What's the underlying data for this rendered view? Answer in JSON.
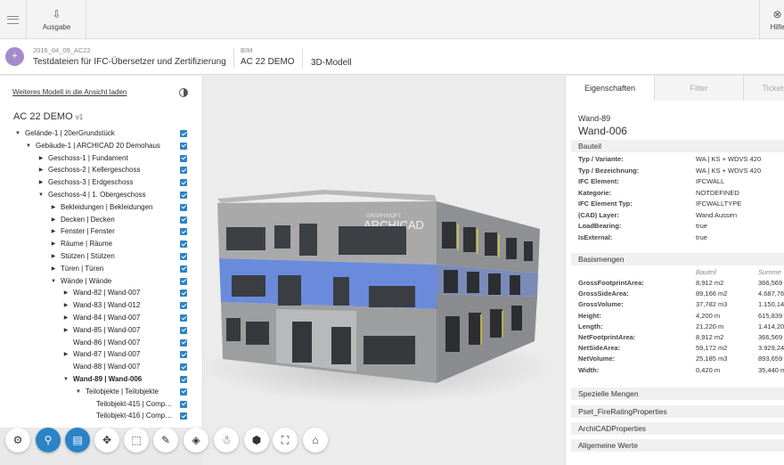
{
  "toolbar": {
    "ausgabe_label": "Ausgabe",
    "hilfe_label": "Hilfe"
  },
  "breadcrumb": {
    "avatar_glyph": "+",
    "project_small": "2016_04_09_AC22",
    "project": "Testdateien für IFC-Übersetzer und Zertifizierung",
    "domain_small": "BIM",
    "model": "AC 22 DEMO",
    "view": "3D-Modell"
  },
  "tree": {
    "add_model_link": "Weiteres Modell in die Ansicht laden",
    "model_title": "AC 22 DEMO",
    "model_version": "v1",
    "items": [
      {
        "label": "Gelände-1 | 20erGrundstück",
        "arrow": "▼"
      },
      {
        "label": "Gebäude-1 | ARCHICAD 20 Demohaus",
        "arrow": "▼"
      },
      {
        "label": "Geschoss-1 | Fundament",
        "arrow": "▶"
      },
      {
        "label": "Geschoss-2 | Kellergeschoss",
        "arrow": "▶"
      },
      {
        "label": "Geschoss-3 | Erdgeschoss",
        "arrow": "▶"
      },
      {
        "label": "Geschoss-4 | 1. Obergeschoss",
        "arrow": "▼"
      },
      {
        "label": "Bekleidungen | Bekleidungen",
        "arrow": "▶"
      },
      {
        "label": "Decken | Decken",
        "arrow": "▶"
      },
      {
        "label": "Fenster | Fenster",
        "arrow": "▶"
      },
      {
        "label": "Räume | Räume",
        "arrow": "▶"
      },
      {
        "label": "Stützen | Stützen",
        "arrow": "▶"
      },
      {
        "label": "Türen | Türen",
        "arrow": "▶"
      },
      {
        "label": "Wände | Wände",
        "arrow": "▼"
      },
      {
        "label": "Wand-82 | Wand-007",
        "arrow": "▶"
      },
      {
        "label": "Wand-83 | Wand-012",
        "arrow": "▶"
      },
      {
        "label": "Wand-84 | Wand-007",
        "arrow": "▶"
      },
      {
        "label": "Wand-85 | Wand-007",
        "arrow": "▶"
      },
      {
        "label": "Wand-86 | Wand-007",
        "arrow": ""
      },
      {
        "label": "Wand-87 | Wand-007",
        "arrow": "▶"
      },
      {
        "label": "Wand-88 | Wand-007",
        "arrow": ""
      },
      {
        "label": "Wand-89 | Wand-006",
        "arrow": "▼"
      },
      {
        "label": "Teilobjekte | Teilobjekte",
        "arrow": "▼"
      },
      {
        "label": "Teilobjekt-415 | Compon…",
        "arrow": ""
      },
      {
        "label": "Teilobjekt-416 | Compon…",
        "arrow": ""
      }
    ]
  },
  "tools": [
    {
      "name": "settings-gear-icon",
      "glyph": "⚙"
    },
    {
      "name": "navigation-mode-icon",
      "glyph": "⚲"
    },
    {
      "name": "storey-view-icon",
      "glyph": "▤"
    },
    {
      "name": "focus-icon",
      "glyph": "✥"
    },
    {
      "name": "selection-box-icon",
      "glyph": "⬚"
    },
    {
      "name": "measure-pencil-icon",
      "glyph": "✎"
    },
    {
      "name": "section-cube-icon",
      "glyph": "◈"
    },
    {
      "name": "walk-person-icon",
      "glyph": "☃"
    },
    {
      "name": "cube-view-icon",
      "glyph": "⬢"
    },
    {
      "name": "fit-view-icon",
      "glyph": "⛶"
    },
    {
      "name": "home-icon",
      "glyph": "⌂"
    }
  ],
  "props": {
    "tabs": [
      "Eigenschaften",
      "Filter",
      "Tickets"
    ],
    "element_small": "Wand-89",
    "element_big": "Wand-006",
    "bauteil_title": "Bauteil",
    "bauteil_rows": [
      {
        "k": "Typ / Variante:",
        "v": "WA | KS + WDVS 420"
      },
      {
        "k": "Typ / Bezeichnung:",
        "v": "WA | KS + WDVS 420"
      },
      {
        "k": "IFC Element:",
        "v": "IFCWALL"
      },
      {
        "k": "Kategorie:",
        "v": "NOTDEFINED"
      },
      {
        "k": "IFC Element Typ:",
        "v": "IFCWALLTYPE"
      },
      {
        "k": "(CAD) Layer:",
        "v": "Wand Aussen"
      },
      {
        "k": "LoadBearing:",
        "v": "true"
      },
      {
        "k": "IsExternal:",
        "v": "true"
      }
    ],
    "basis_title": "Basismengen",
    "col_bauteil": "Bauteil",
    "col_summe": "Summe",
    "basis_rows": [
      {
        "k": "GrossFootprintArea:",
        "v": "8,912 m2",
        "s": "366,569 m2"
      },
      {
        "k": "GrossSideArea:",
        "v": "89,166 m2",
        "s": "4.687,76 m2"
      },
      {
        "k": "GrossVolume:",
        "v": "37,782 m3",
        "s": "1.150,14 m3"
      },
      {
        "k": "Height:",
        "v": "4,200 m",
        "s": "615,839 m"
      },
      {
        "k": "Length:",
        "v": "21,220 m",
        "s": "1.414,20 m"
      },
      {
        "k": "NetFootprintArea:",
        "v": "8,912 m2",
        "s": "366,569 m2"
      },
      {
        "k": "NetSideArea:",
        "v": "59,172 m2",
        "s": "3.929,24 m2"
      },
      {
        "k": "NetVolume:",
        "v": "25,185 m3",
        "s": "893,659 m3"
      },
      {
        "k": "Width:",
        "v": "0,420 m",
        "s": "35,440 m"
      }
    ],
    "collapsed_sections": [
      "Spezielle Mengen",
      "Pset_FireRatingProperties",
      "ArchiCADProperties",
      "Allgemeine Werte"
    ]
  },
  "building": {
    "sign": "ARCHICAD",
    "sign_small": "GRAPHISOFT"
  }
}
